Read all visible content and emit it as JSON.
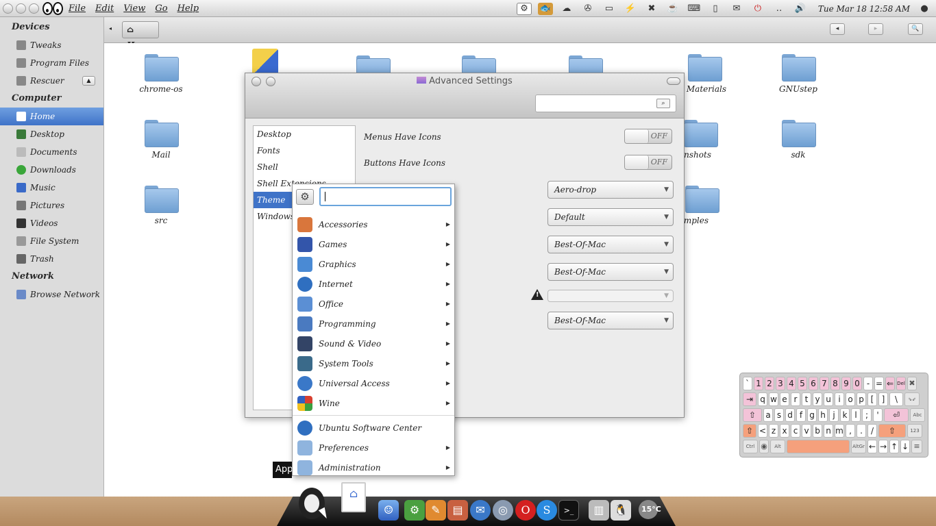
{
  "top_panel": {
    "menu": [
      "File",
      "Edit",
      "View",
      "Go",
      "Help"
    ],
    "clock": "Tue Mar 18 12:58 AM",
    "tray_icons": [
      "gear-icon",
      "goldfish-icon",
      "cloud-icon",
      "film-reel-icon",
      "display-icon",
      "lightning-icon",
      "dropbox-icon",
      "coffee-icon",
      "keyboard-icon",
      "clipboard-icon",
      "mail-icon",
      "power-icon",
      "network-icon",
      "volume-icon",
      "apple-icon"
    ]
  },
  "sidebar": {
    "devices_heading": "Devices",
    "devices": [
      {
        "label": "Tweaks",
        "icon": "drive-icon"
      },
      {
        "label": "Program Files",
        "icon": "drive-icon"
      },
      {
        "label": "Rescuer",
        "icon": "drive-icon",
        "eject": "▲"
      }
    ],
    "computer_heading": "Computer",
    "computer": [
      {
        "label": "Home",
        "icon": "home-icon"
      },
      {
        "label": "Desktop",
        "icon": "desktop-icon"
      },
      {
        "label": "Documents",
        "icon": "documents-icon"
      },
      {
        "label": "Downloads",
        "icon": "downloads-icon"
      },
      {
        "label": "Music",
        "icon": "music-icon"
      },
      {
        "label": "Pictures",
        "icon": "pictures-icon"
      },
      {
        "label": "Videos",
        "icon": "videos-icon"
      },
      {
        "label": "File System",
        "icon": "filesystem-icon"
      },
      {
        "label": "Trash",
        "icon": "trash-icon"
      }
    ],
    "network_heading": "Network",
    "network": [
      {
        "label": "Browse Network",
        "icon": "network-icon"
      }
    ]
  },
  "toolbar": {
    "breadcrumb": "Home",
    "back": "◂",
    "fwd": "▸",
    "search_icon": "🔍"
  },
  "files": [
    {
      "name": "chrome-os"
    },
    {
      "name": "ve Materials"
    },
    {
      "name": "GNUstep"
    },
    {
      "name": "Mail"
    },
    {
      "name": "eenshots"
    },
    {
      "name": "sdk"
    },
    {
      "name": "src"
    },
    {
      "name": "amples"
    }
  ],
  "advanced_settings": {
    "title": "Advanced Settings",
    "sections": [
      "Desktop",
      "Fonts",
      "Shell",
      "Shell Extensions",
      "Theme",
      "Windows"
    ],
    "settings": [
      {
        "label": "Menus Have Icons",
        "value": "OFF"
      },
      {
        "label": "Buttons Have Icons",
        "value": "OFF"
      }
    ],
    "combos": [
      "Aero-drop",
      "Default",
      "Best-Of-Mac",
      "Best-Of-Mac",
      "",
      "Best-Of-Mac"
    ]
  },
  "app_menu": {
    "categories": [
      {
        "label": "Accessories",
        "icon": "accessories-icon",
        "color": "#d9763c"
      },
      {
        "label": "Games",
        "icon": "games-icon",
        "color": "#3355aa"
      },
      {
        "label": "Graphics",
        "icon": "graphics-icon",
        "color": "#4a8ad4"
      },
      {
        "label": "Internet",
        "icon": "internet-icon",
        "color": "#2f6fc0"
      },
      {
        "label": "Office",
        "icon": "office-icon",
        "color": "#5b8fd4"
      },
      {
        "label": "Programming",
        "icon": "programming-icon",
        "color": "#4a7ac0"
      },
      {
        "label": "Sound & Video",
        "icon": "sound-video-icon",
        "color": "#334466"
      },
      {
        "label": "System Tools",
        "icon": "system-tools-icon",
        "color": "#3a6a8a"
      },
      {
        "label": "Universal Access",
        "icon": "universal-access-icon",
        "color": "#3a78c8"
      },
      {
        "label": "Wine",
        "icon": "wine-icon",
        "color": "#c84030"
      }
    ],
    "extras": [
      {
        "label": "Ubuntu Software Center",
        "icon": "software-center-icon",
        "color": "#2f6fc0",
        "submenu": false
      },
      {
        "label": "Preferences",
        "icon": "preferences-folder-icon",
        "color": "#8fb4de",
        "submenu": true
      },
      {
        "label": "Administration",
        "icon": "administration-folder-icon",
        "color": "#8fb4de",
        "submenu": true
      }
    ],
    "submenu_arrow": "▶"
  },
  "tooltip": "App",
  "dock": {
    "icons": [
      "tux-icon",
      "home-icon",
      "finder-icon",
      "settings-icon",
      "inkscape-icon",
      "books-icon",
      "thunderbird-icon",
      "cd-icon",
      "opera-icon",
      "skype-icon",
      "terminal-icon",
      "trash-icon",
      "tux-small-icon",
      "weather-icon"
    ],
    "temperature": "15°C"
  },
  "keyboard": {
    "row1": [
      "`",
      "1",
      "2",
      "3",
      "4",
      "5",
      "6",
      "7",
      "8",
      "9",
      "0",
      "-",
      "=",
      "⇐",
      "Del",
      "✖"
    ],
    "row2": [
      "⇥",
      "q",
      "w",
      "e",
      "r",
      "t",
      "y",
      "u",
      "i",
      "o",
      "p",
      "[",
      "]",
      "\\",
      "⇘⇙"
    ],
    "row3": [
      "⇧",
      "a",
      "s",
      "d",
      "f",
      "g",
      "h",
      "j",
      "k",
      "l",
      ";",
      "'",
      "⏎",
      "Abc"
    ],
    "row4": [
      "⇧",
      "<",
      "z",
      "x",
      "c",
      "v",
      "b",
      "n",
      "m",
      ",",
      ".",
      "/",
      "⇧",
      "123"
    ],
    "row5": [
      "Ctrl",
      "◉",
      "Alt",
      "",
      "AltGr",
      "←",
      "→",
      "↑",
      "↓",
      "≡"
    ]
  }
}
